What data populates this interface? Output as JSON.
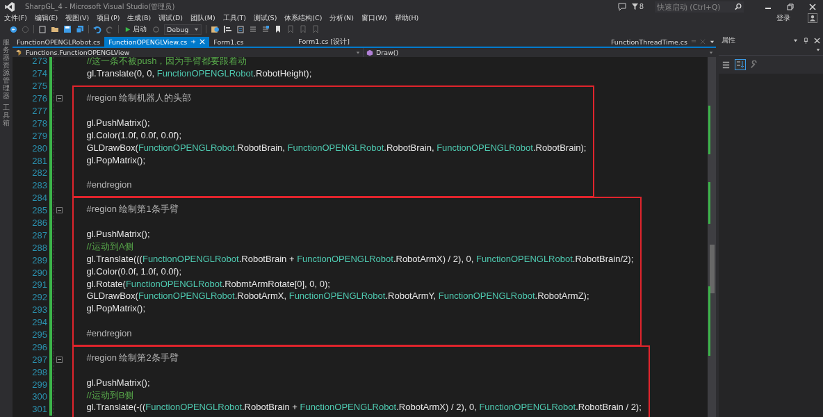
{
  "window": {
    "title": "SharpGL_4 - Microsoft Visual Studio(管理员)",
    "notifications": "8",
    "quick_launch": {
      "placeholder": "快速启动 (Ctrl+Q)"
    },
    "sign_in": "登录"
  },
  "menu": [
    "文件(F)",
    "编辑(E)",
    "视图(V)",
    "项目(P)",
    "生成(B)",
    "调试(D)",
    "团队(M)",
    "工具(T)",
    "测试(S)",
    "体系结构(C)",
    "分析(N)",
    "窗口(W)",
    "帮助(H)"
  ],
  "toolbar": {
    "start": "启动",
    "configuration": "Debug"
  },
  "side_tabs": [
    "服务器资源管理器",
    "工具箱"
  ],
  "tabs": [
    {
      "label": "FunctionOPENGLRobot.cs",
      "selected": false
    },
    {
      "label": "FunctionOPENGLView.cs",
      "selected": true
    },
    {
      "label": "Form1.cs",
      "selected": false
    },
    {
      "label": "Form1.cs [设计]",
      "selected": false
    }
  ],
  "overflow_tab": "FunctionThreadTime.cs",
  "navigation": {
    "type": "Functions.FunctionOPENGLView",
    "member": "Draw()"
  },
  "code": [
    {
      "kind": "lines",
      "lines": [
        {
          "number": "273",
          "fold": false,
          "tokens": [
            {
              "kind": "comment",
              "text": "//这一条不被push，因为手臂都要跟着动"
            }
          ]
        },
        {
          "number": "274",
          "fold": false,
          "tokens": [
            {
              "kind": "plain",
              "text": "gl.Translate(0, 0, "
            },
            {
              "kind": "type",
              "text": "FunctionOPENGLRobot"
            },
            {
              "kind": "plain",
              "text": ".RobotHeight);"
            }
          ]
        },
        {
          "number": "275",
          "fold": false
        }
      ]
    },
    {
      "kind": "highlight",
      "lines": [
        {
          "number": "276",
          "fold": true,
          "tokens": [
            {
              "kind": "region",
              "text": "#region 绘制机器人的头部"
            }
          ]
        },
        {
          "number": "277",
          "fold": false
        },
        {
          "number": "278",
          "fold": false,
          "tokens": [
            {
              "kind": "plain",
              "text": "gl.PushMatrix();"
            }
          ]
        },
        {
          "number": "279",
          "fold": false,
          "tokens": [
            {
              "kind": "plain",
              "text": "gl.Color(1.0f, 0.0f, 0.0f);"
            }
          ]
        },
        {
          "number": "280",
          "fold": false,
          "tokens": [
            {
              "kind": "plain",
              "text": "GLDrawBox("
            },
            {
              "kind": "type",
              "text": "FunctionOPENGLRobot"
            },
            {
              "kind": "plain",
              "text": ".RobotBrain, "
            },
            {
              "kind": "type",
              "text": "FunctionOPENGLRobot"
            },
            {
              "kind": "plain",
              "text": ".RobotBrain, "
            },
            {
              "kind": "type",
              "text": "FunctionOPENGLRobot"
            },
            {
              "kind": "plain",
              "text": ".RobotBrain);"
            }
          ]
        },
        {
          "number": "281",
          "fold": false,
          "tokens": [
            {
              "kind": "plain",
              "text": "gl.PopMatrix();"
            }
          ]
        },
        {
          "number": "282",
          "fold": false
        },
        {
          "number": "283",
          "fold": false,
          "tokens": [
            {
              "kind": "region",
              "text": "#endregion"
            }
          ]
        }
      ]
    },
    {
      "kind": "lines",
      "lines": [
        {
          "number": "284",
          "fold": false
        }
      ]
    },
    {
      "kind": "highlight",
      "lines": [
        {
          "number": "285",
          "fold": true,
          "tokens": [
            {
              "kind": "region",
              "text": "#region 绘制第1条手臂"
            }
          ]
        },
        {
          "number": "286",
          "fold": false
        },
        {
          "number": "287",
          "fold": false,
          "tokens": [
            {
              "kind": "plain",
              "text": "gl.PushMatrix();"
            }
          ]
        },
        {
          "number": "288",
          "fold": false,
          "tokens": [
            {
              "kind": "comment",
              "text": "//运动到A侧"
            }
          ]
        },
        {
          "number": "289",
          "fold": false,
          "tokens": [
            {
              "kind": "plain",
              "text": "gl.Translate((("
            },
            {
              "kind": "type",
              "text": "FunctionOPENGLRobot"
            },
            {
              "kind": "plain",
              "text": ".RobotBrain + "
            },
            {
              "kind": "type",
              "text": "FunctionOPENGLRobot"
            },
            {
              "kind": "plain",
              "text": ".RobotArmX) / 2), 0, "
            },
            {
              "kind": "type",
              "text": "FunctionOPENGLRobot"
            },
            {
              "kind": "plain",
              "text": ".RobotBrain/2);"
            }
          ]
        },
        {
          "number": "290",
          "fold": false,
          "tokens": [
            {
              "kind": "plain",
              "text": "gl.Color(0.0f, 1.0f, 0.0f);"
            }
          ]
        },
        {
          "number": "291",
          "fold": false,
          "tokens": [
            {
              "kind": "plain",
              "text": "gl.Rotate("
            },
            {
              "kind": "type",
              "text": "FunctionOPENGLRobot"
            },
            {
              "kind": "plain",
              "text": ".RobmtArmRotate[0], 0, 0);"
            }
          ]
        },
        {
          "number": "292",
          "fold": false,
          "tokens": [
            {
              "kind": "plain",
              "text": "GLDrawBox("
            },
            {
              "kind": "type",
              "text": "FunctionOPENGLRobot"
            },
            {
              "kind": "plain",
              "text": ".RobotArmX, "
            },
            {
              "kind": "type",
              "text": "FunctionOPENGLRobot"
            },
            {
              "kind": "plain",
              "text": ".RobotArmY, "
            },
            {
              "kind": "type",
              "text": "FunctionOPENGLRobot"
            },
            {
              "kind": "plain",
              "text": ".RobotArmZ);"
            }
          ]
        },
        {
          "number": "293",
          "fold": false,
          "tokens": [
            {
              "kind": "plain",
              "text": "gl.PopMatrix();"
            }
          ]
        },
        {
          "number": "294",
          "fold": false
        },
        {
          "number": "295",
          "fold": false,
          "tokens": [
            {
              "kind": "region",
              "text": "#endregion"
            }
          ]
        }
      ]
    },
    {
      "kind": "lines",
      "lines": [
        {
          "number": "296",
          "fold": false
        }
      ]
    },
    {
      "kind": "highlight",
      "lines": [
        {
          "number": "297",
          "fold": true,
          "tokens": [
            {
              "kind": "region",
              "text": "#region 绘制第2条手臂"
            }
          ]
        },
        {
          "number": "298",
          "fold": false
        },
        {
          "number": "299",
          "fold": false,
          "tokens": [
            {
              "kind": "plain",
              "text": "gl.PushMatrix();"
            }
          ]
        },
        {
          "number": "300",
          "fold": false,
          "tokens": [
            {
              "kind": "comment",
              "text": "//运动到B侧"
            }
          ]
        },
        {
          "number": "301",
          "fold": false,
          "tokens": [
            {
              "kind": "plain",
              "text": "gl.Translate(-(("
            },
            {
              "kind": "type",
              "text": "FunctionOPENGLRobot"
            },
            {
              "kind": "plain",
              "text": ".RobotBrain + "
            },
            {
              "kind": "type",
              "text": "FunctionOPENGLRobot"
            },
            {
              "kind": "plain",
              "text": ".RobotArmX) / 2), 0, "
            },
            {
              "kind": "type",
              "text": "FunctionOPENGLRobot"
            },
            {
              "kind": "plain",
              "text": ".RobotBrain / 2);"
            }
          ]
        }
      ]
    }
  ],
  "properties_panel": {
    "title": "属性"
  }
}
